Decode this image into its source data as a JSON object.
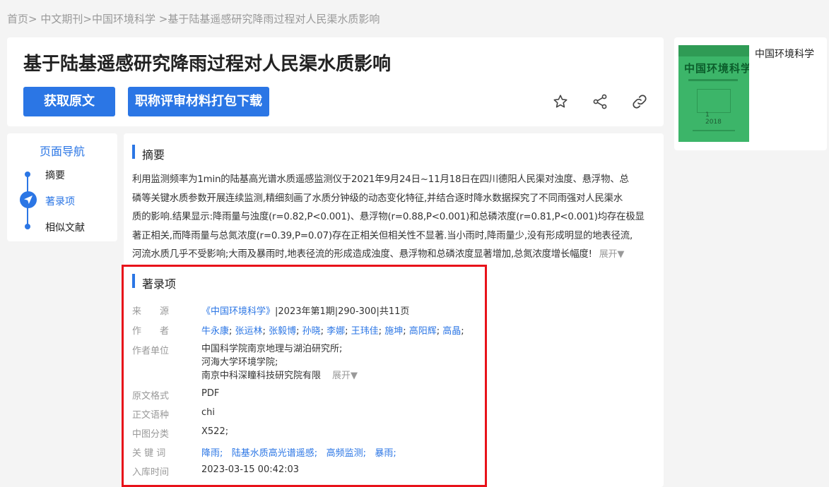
{
  "breadcrumb": {
    "items": [
      "首页",
      "中文期刊",
      "中国环境科学",
      "基于陆基遥感研究降雨过程对人民渠水质影响"
    ],
    "separator": ">"
  },
  "article": {
    "title": "基于陆基遥感研究降雨过程对人民渠水质影响"
  },
  "actions": {
    "get_original": "获取原文",
    "download_package": "职称评审材料打包下载",
    "icons": [
      "star-icon",
      "share-icon",
      "link-icon"
    ]
  },
  "journal": {
    "name": "中国环境科学",
    "cover_title": "中国环境科学",
    "cover_issue": "1",
    "cover_year": "2018"
  },
  "nav": {
    "title": "页面导航",
    "items": [
      "摘要",
      "著录项",
      "相似文献"
    ],
    "active_index": 1
  },
  "abstract": {
    "heading": "摘要",
    "lines": [
      "利用监测频率为1min的陆基高光谱水质遥感监测仪于2021年9月24日~11月18日在四川德阳人民渠对浊度、悬浮物、总",
      "磷等关键水质参数开展连续监测,精细刻画了水质分钟级的动态变化特征,并结合逐时降水数据探究了不同雨强对人民渠水",
      "质的影响.结果显示:降雨量与浊度(r=0.82,P<0.001)、悬浮物(r=0.88,P<0.001)和总磷浓度(r=0.81,P<0.001)均存在极显",
      "著正相关,而降雨量与总氮浓度(r=0.39,P=0.07)存在正相关但相关性不显著.当小雨时,降雨量少,没有形成明显的地表径流,",
      "河流水质几乎不受影响;大雨及暴雨时,地表径流的形成造成浊度、悬浮物和总磷浓度显著增加,总氮浓度增长幅度!"
    ],
    "expand_label": "展开▼"
  },
  "record": {
    "heading": "著录项",
    "source_label": "来　　源",
    "source_journal": "《中国环境科学》",
    "source_rest": "|2023年第1期|290-300|共11页",
    "authors_label": "作　　者",
    "authors": [
      "牛永康",
      "张运林",
      "张毅博",
      "孙晓",
      "李娜",
      "王玮佳",
      "施坤",
      "高阳辉",
      "高晶"
    ],
    "affiliation_label": "作者单位",
    "affiliations": [
      "中国科学院南京地理与湖泊研究所;",
      "河海大学环境学院;",
      "南京中科深瞳科技研究院有限"
    ],
    "affiliation_expand": "展开▼",
    "format_label": "原文格式",
    "format": "PDF",
    "language_label": "正文语种",
    "language": "chi",
    "clc_label": "中图分类",
    "clc": "X522;",
    "keywords_label": "关 键 词",
    "keywords": [
      "降雨;",
      "陆基水质高光谱遥感;",
      "高频监测;",
      "暴雨;"
    ],
    "date_label": "入库时间",
    "date": "2023-03-15 00:42:03"
  },
  "colors": {
    "accent": "#2b76e5",
    "highlight": "#e8121a",
    "cover_green": "#3cb569"
  }
}
